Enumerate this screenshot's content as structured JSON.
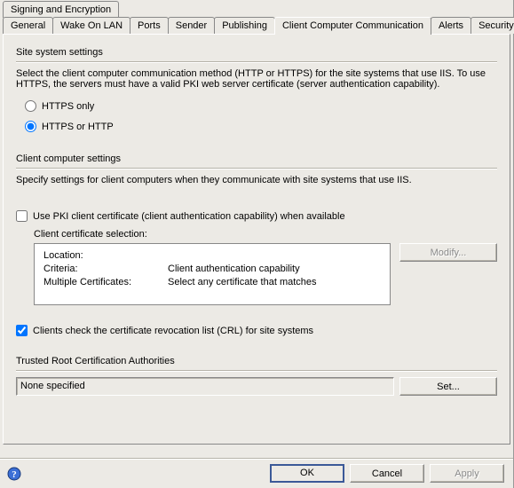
{
  "tabs": {
    "row1": [
      "Signing and Encryption"
    ],
    "row2": [
      "General",
      "Wake On LAN",
      "Ports",
      "Sender",
      "Publishing",
      "Client Computer Communication",
      "Alerts",
      "Security"
    ],
    "selected": "Client Computer Communication"
  },
  "section1": {
    "title": "Site system settings",
    "desc": "Select the client computer communication method (HTTP or HTTPS) for the site systems that use IIS. To use HTTPS, the servers must have a valid PKI web server certificate (server authentication capability)."
  },
  "radios": {
    "opt1": "HTTPS only",
    "opt2": "HTTPS or HTTP",
    "selected": "opt2"
  },
  "section2": {
    "title": "Client computer settings",
    "desc": "Specify settings for client computers when they communicate with site systems that use IIS."
  },
  "pki_checkbox_label": "Use PKI client certificate (client authentication capability) when available",
  "certsel": {
    "title": "Client certificate selection:",
    "k1": "Location:",
    "v1": "",
    "k2": "Criteria:",
    "v2": "Client authentication capability",
    "k3": "Multiple Certificates:",
    "v3": "Select any certificate that matches",
    "modify_btn": "Modify..."
  },
  "crl_checkbox_label": "Clients check the certificate revocation list (CRL) for site systems",
  "trusted": {
    "title": "Trusted Root Certification Authorities",
    "value": "None specified",
    "set_btn": "Set..."
  },
  "footer": {
    "ok": "OK",
    "cancel": "Cancel",
    "apply": "Apply"
  }
}
